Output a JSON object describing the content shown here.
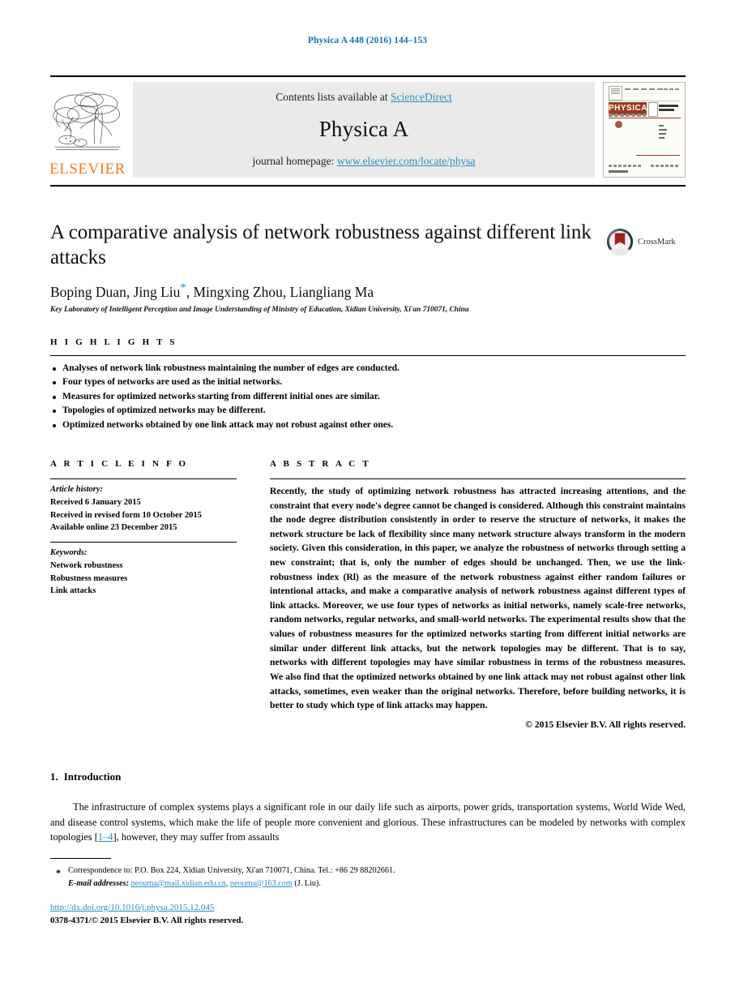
{
  "running_head": "Physica A 448 (2016) 144–153",
  "masthead": {
    "elsevier_wordmark": "ELSEVIER",
    "contents_prefix": "Contents lists available at ",
    "contents_link": "ScienceDirect",
    "journal_name": "Physica A",
    "homepage_prefix": "journal homepage: ",
    "homepage_url": "www.elsevier.com/locate/physa",
    "cover": {
      "journal_word": "PHYSICA",
      "volume_letter": "A",
      "subtitle": "STATISTICAL MECHANICS AND ITS APPLICATIONS"
    }
  },
  "article": {
    "title": "A comparative analysis of network robustness against different link attacks",
    "authors": "Boping Duan, Jing Liu",
    "authors_star": "*",
    "authors_rest": ", Mingxing Zhou, Liangliang Ma",
    "affiliation": "Key Laboratory of Intelligent Perception and Image Understanding of Ministry of Education, Xidian University, Xi'an 710071, China",
    "crossmark_label": "CrossMark"
  },
  "highlights": {
    "heading": "H I G H L I G H T S",
    "items": [
      "Analyses of network link robustness maintaining the number of edges are conducted.",
      "Four types of networks are used as the initial networks.",
      "Measures for optimized networks starting from different initial ones are similar.",
      "Topologies of optimized networks may be different.",
      "Optimized networks obtained by one link attack may not robust against other ones."
    ]
  },
  "article_info": {
    "heading": "A R T I C L E     I N F O",
    "history_label": "Article history:",
    "history": [
      "Received 6 January 2015",
      "Received in revised form 10 October 2015",
      "Available online 23 December 2015"
    ],
    "keywords_label": "Keywords:",
    "keywords": [
      "Network robustness",
      "Robustness measures",
      "Link attacks"
    ]
  },
  "abstract": {
    "heading": "A B S T R A C T",
    "body": "Recently, the study of optimizing network robustness has attracted increasing attentions, and the constraint that every node's degree cannot be changed is considered. Although this constraint maintains the node degree distribution consistently in order to reserve the structure of networks, it makes the network structure be lack of flexibility since many network structure always transform in the modern society. Given this consideration, in this paper, we analyze the robustness of networks through setting a new constraint; that is, only the number of edges should be unchanged. Then, we use the link-robustness index (Rl) as the measure of the network robustness against either random failures or intentional attacks, and make a comparative analysis of network robustness against different types of link attacks. Moreover, we use four types of networks as initial networks, namely scale-free networks, random networks, regular networks, and small-world networks. The experimental results show that the values of robustness measures for the optimized networks starting from different initial networks are similar under different link attacks, but the network topologies may be different. That is to say, networks with different topologies may have similar robustness in terms of the robustness measures. We also find that the optimized networks obtained by one link attack may not robust against other link attacks, sometimes, even weaker than the original networks. Therefore, before building networks, it is better to study which type of link attacks may happen.",
    "copyright": "© 2015 Elsevier B.V. All rights reserved."
  },
  "introduction": {
    "number": "1.",
    "heading": "Introduction",
    "paragraph_part1": "The infrastructure of complex systems plays a significant role in our daily life such as airports, power grids, transportation systems, World Wide Wed, and disease control systems, which make the life of people more convenient and glorious. These infrastructures can be modeled by networks with complex topologies [",
    "citation": "1–4",
    "paragraph_part2": "], however, they may suffer from assaults"
  },
  "footer": {
    "correspondence": "Correspondence to: P.O. Box 224, Xidian University, Xi'an 710071, China. Tel.: +86 29 88202661.",
    "email_label": "E-mail addresses:",
    "email1": "neouma@mail.xidian.edu.cn",
    "email_sep": ", ",
    "email2": "neouma@163.com",
    "email_attrib": " (J. Liu).",
    "doi": "http://dx.doi.org/10.1016/j.physa.2015.12.045",
    "issn": "0378-4371/© 2015 Elsevier B.V. All rights reserved."
  },
  "colors": {
    "link": "#2b8ec4",
    "running_head": "#1273a8",
    "elsevier_orange": "#F07E22",
    "cover_brown": "#9a3c1c"
  }
}
